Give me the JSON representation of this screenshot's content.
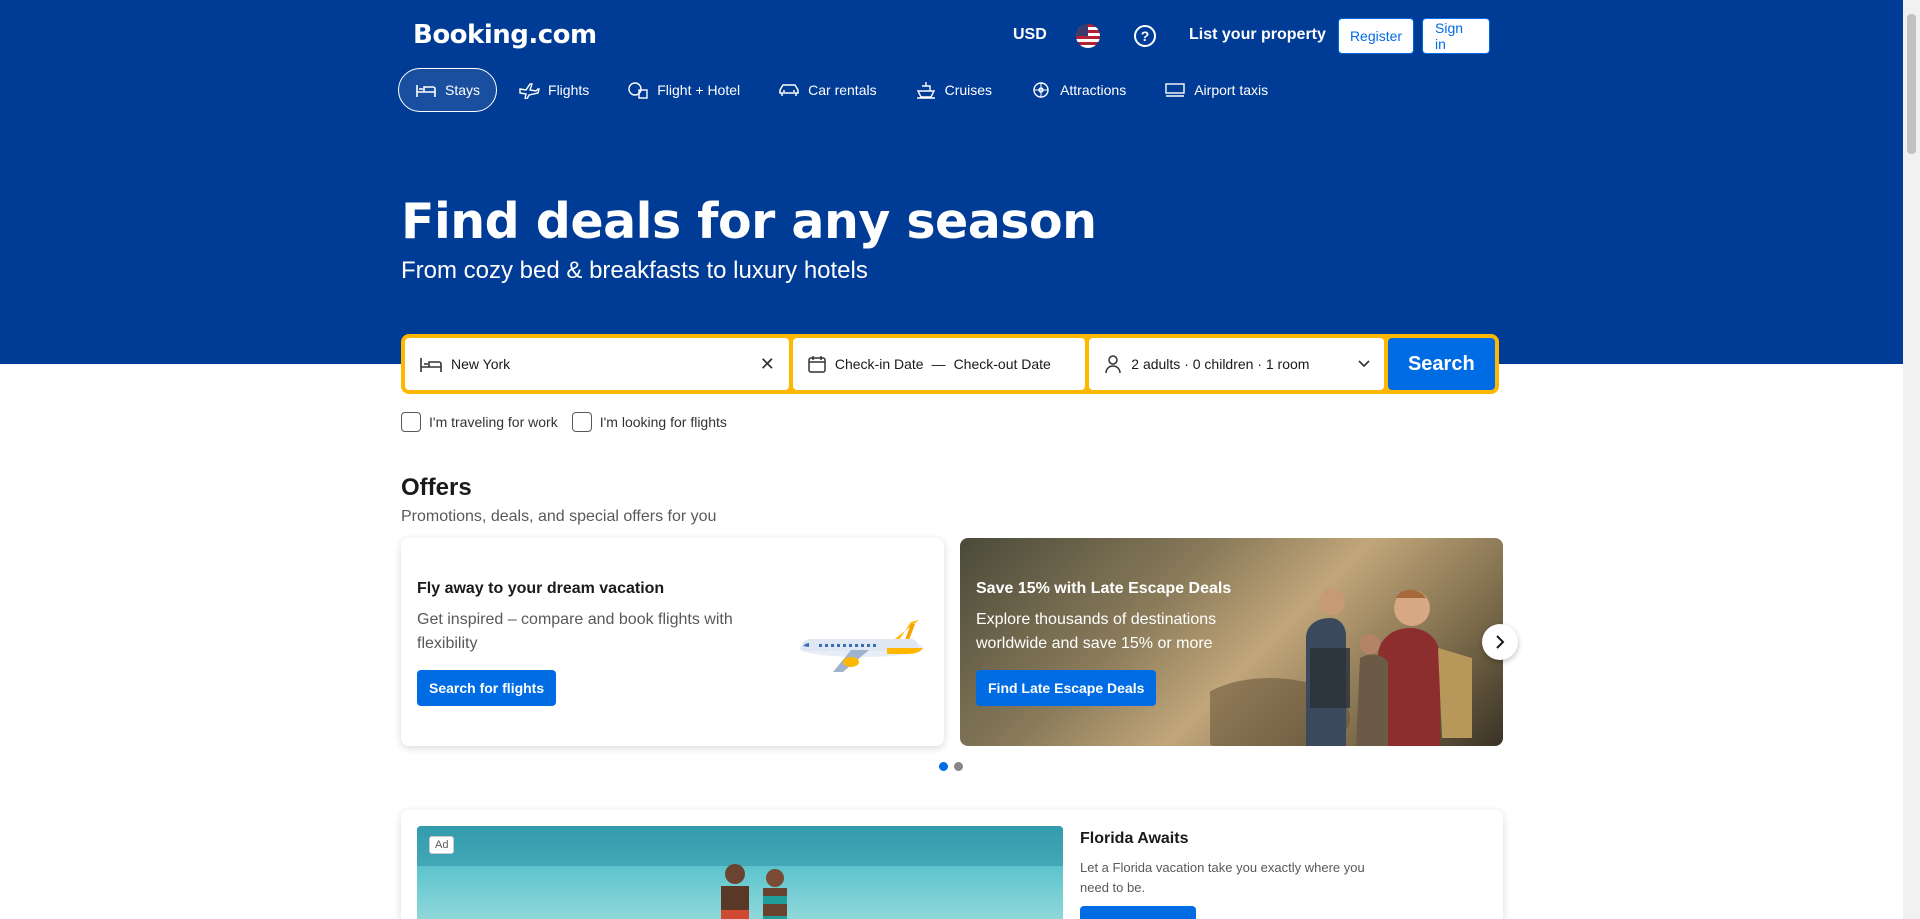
{
  "header": {
    "logo": "Booking.com",
    "currency": "USD",
    "help_glyph": "?",
    "list_property": "List your property",
    "register": "Register",
    "sign_in": "Sign in"
  },
  "nav": {
    "items": [
      {
        "label": "Stays",
        "icon": "bed-icon"
      },
      {
        "label": "Flights",
        "icon": "plane-icon"
      },
      {
        "label": "Flight + Hotel",
        "icon": "flight-hotel-icon"
      },
      {
        "label": "Car rentals",
        "icon": "car-icon"
      },
      {
        "label": "Cruises",
        "icon": "ship-icon"
      },
      {
        "label": "Attractions",
        "icon": "attractions-icon"
      },
      {
        "label": "Airport taxis",
        "icon": "taxi-icon"
      }
    ]
  },
  "hero": {
    "title": "Find deals for any season",
    "subtitle": "From cozy bed & breakfasts to luxury hotels"
  },
  "search": {
    "destination": "New York",
    "checkin": "Check-in Date",
    "dash": "—",
    "checkout": "Check-out Date",
    "guests": "2 adults · 0 children · 1 room",
    "button": "Search"
  },
  "checkboxes": {
    "work": "I'm traveling for work",
    "flights": "I'm looking for flights"
  },
  "offers": {
    "title": "Offers",
    "subtitle": "Promotions, deals, and special offers for you",
    "cards": [
      {
        "title": "Fly away to your dream vacation",
        "desc": "Get inspired – compare and book flights with flexibility",
        "button": "Search for flights"
      },
      {
        "title": "Save 15% with Late Escape Deals",
        "desc": "Explore thousands of destinations worldwide and save 15% or more",
        "button": "Find Late Escape Deals"
      }
    ]
  },
  "ad": {
    "label": "Ad",
    "title": "Florida Awaits",
    "desc": "Let a Florida vacation take you exactly where you need to be."
  },
  "colors": {
    "brand_blue": "#003b95",
    "action_blue": "#006ce4",
    "search_border": "#ffb700"
  }
}
